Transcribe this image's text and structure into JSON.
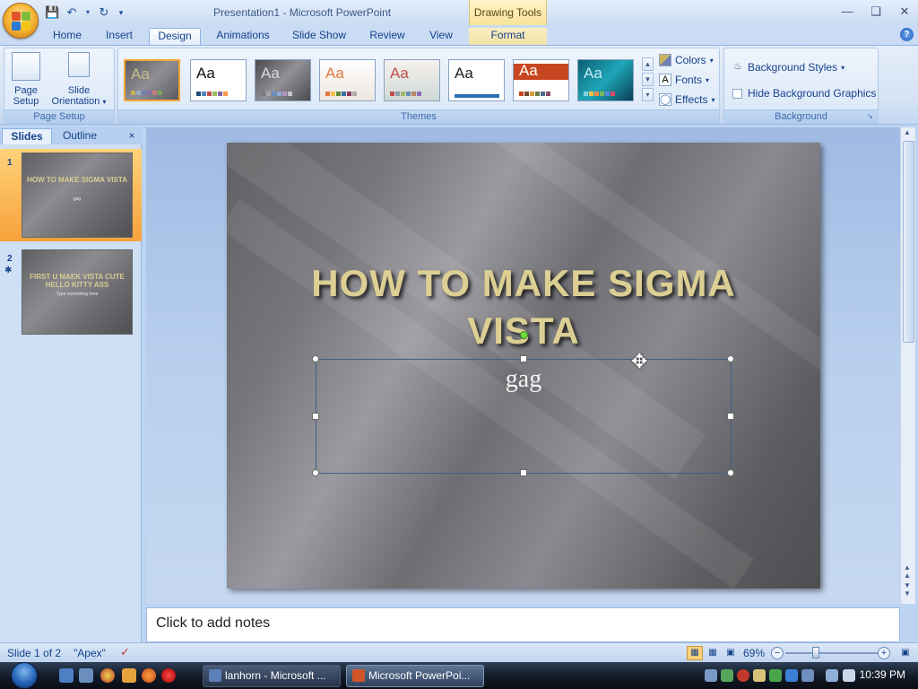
{
  "window": {
    "title": "Presentation1 - Microsoft PowerPoint",
    "context_tab_group": "Drawing Tools"
  },
  "tabs": [
    {
      "label": "Home"
    },
    {
      "label": "Insert"
    },
    {
      "label": "Design"
    },
    {
      "label": "Animations"
    },
    {
      "label": "Slide Show"
    },
    {
      "label": "Review"
    },
    {
      "label": "View"
    },
    {
      "label": "Format"
    }
  ],
  "ribbon": {
    "page_setup": {
      "group_label": "Page Setup",
      "page_setup_label_1": "Page",
      "page_setup_label_2": "Setup",
      "orientation_label_1": "Slide",
      "orientation_label_2": "Orientation"
    },
    "themes": {
      "group_label": "Themes",
      "sample_text": "Aa"
    },
    "theme_options": {
      "colors": "Colors",
      "fonts": "Fonts",
      "effects": "Effects"
    },
    "background": {
      "group_label": "Background",
      "styles": "Background Styles",
      "hide_graphics": "Hide Background Graphics"
    }
  },
  "left_pane": {
    "tab_slides": "Slides",
    "tab_outline": "Outline",
    "close": "×",
    "slides": [
      {
        "number": "1",
        "title": "HOW TO MAKE SIGMA VISTA",
        "subtitle": "gag"
      },
      {
        "number": "2",
        "title": "FIRST U MAEK VISTA CUTE HELLO KITTY ASS",
        "subtitle": "Type something here"
      }
    ]
  },
  "slide": {
    "title": "HOW TO MAKE SIGMA VISTA",
    "subtitle": "gag"
  },
  "notes": {
    "placeholder": "Click to add notes"
  },
  "status": {
    "slide_counter": "Slide 1 of 2",
    "theme_name": "\"Apex\"",
    "zoom": "69%",
    "zoom_level": 0.69
  },
  "taskbar": {
    "buttons": [
      {
        "label": "lanhorn - Microsoft ..."
      },
      {
        "label": "Microsoft PowerPoi..."
      }
    ],
    "clock": "10:39 PM"
  },
  "colors": {
    "ribbon_bg": "#d5e3f5",
    "title_gold": "#dccf93",
    "selection_green": "#6fdc3f"
  }
}
